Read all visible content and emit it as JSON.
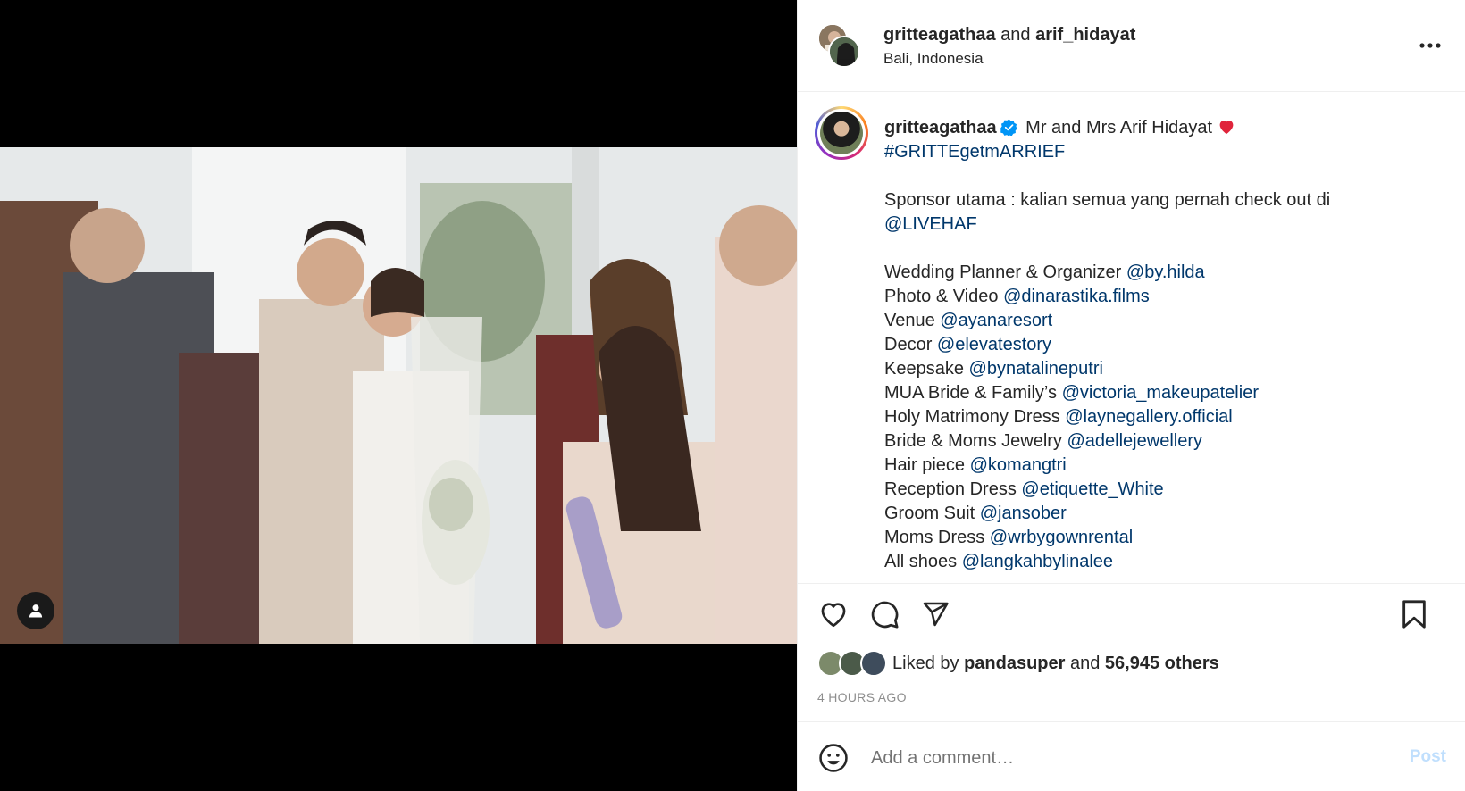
{
  "header": {
    "user1": "gritteagathaa",
    "and_text": "and",
    "user2": "arif_hidayat",
    "location": "Bali, Indonesia"
  },
  "caption": {
    "username": "gritteagathaa",
    "title": "Mr and Mrs Arif Hidayat",
    "heart": "❤️",
    "hashtag": "#GRITTEgetmARRIEF",
    "sponsor_text": "Sponsor utama : kalian semua yang pernah check out di",
    "sponsor_handle": "@LIVEHAF",
    "credits": [
      {
        "label": "Wedding Planner & Organizer",
        "handle": "@by.hilda"
      },
      {
        "label": "Photo & Video",
        "handle": "@dinarastika.films"
      },
      {
        "label": "Venue",
        "handle": "@ayanaresort"
      },
      {
        "label": "Decor",
        "handle": "@elevatestory"
      },
      {
        "label": "Keepsake",
        "handle": "@bynatalineputri"
      },
      {
        "label": "MUA Bride & Family’s",
        "handle": "@victoria_makeupatelier"
      },
      {
        "label": "Holy Matrimony Dress",
        "handle": "@laynegallery.official"
      },
      {
        "label": "Bride & Moms Jewelry",
        "handle": "@adellejewellery"
      },
      {
        "label": "Hair piece",
        "handle": "@komangtri"
      },
      {
        "label": "Reception Dress",
        "handle": "@etiquette_White"
      },
      {
        "label": "Groom Suit",
        "handle": "@jansober"
      },
      {
        "label": "Moms Dress",
        "handle": "@wrbygownrental"
      },
      {
        "label": "All shoes",
        "handle": "@langkahbylinalee"
      }
    ]
  },
  "likes": {
    "prefix": "Liked by",
    "user": "pandasuper",
    "and_text": "and",
    "count": "56,945 others"
  },
  "time": "4 HOURS AGO",
  "comment": {
    "placeholder": "Add a comment…",
    "post_label": "Post"
  },
  "icons": {
    "tag": "user-tag-icon",
    "more": "more-options-icon",
    "like": "heart-icon",
    "comment": "comment-icon",
    "share": "send-icon",
    "save": "bookmark-icon",
    "emoji": "emoji-icon",
    "verified": "verified-badge-icon"
  },
  "colors": {
    "link": "#00376b",
    "verified": "#0095f6",
    "post_disabled": "#c0dffd",
    "muted": "#8e8e8e"
  }
}
